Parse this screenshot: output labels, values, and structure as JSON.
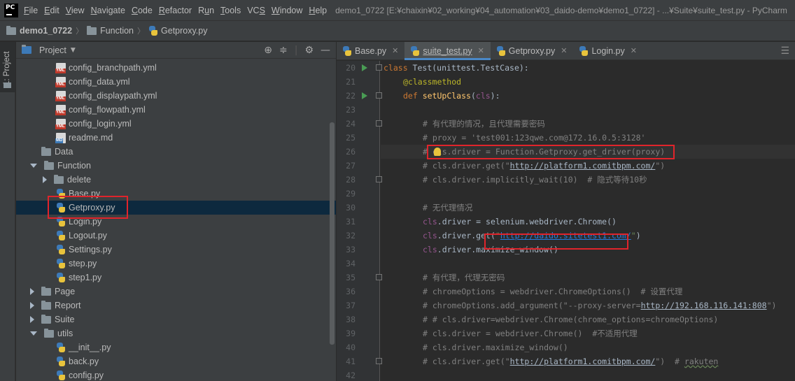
{
  "menubar": {
    "logo": "PC",
    "items": [
      {
        "pre": "",
        "ul": "F",
        "post": "ile"
      },
      {
        "pre": "",
        "ul": "E",
        "post": "dit"
      },
      {
        "pre": "",
        "ul": "V",
        "post": "iew"
      },
      {
        "pre": "",
        "ul": "N",
        "post": "avigate"
      },
      {
        "pre": "",
        "ul": "C",
        "post": "ode"
      },
      {
        "pre": "",
        "ul": "R",
        "post": "efactor"
      },
      {
        "pre": "R",
        "ul": "u",
        "post": "n"
      },
      {
        "pre": "",
        "ul": "T",
        "post": "ools"
      },
      {
        "pre": "VC",
        "ul": "S",
        "post": ""
      },
      {
        "pre": "",
        "ul": "W",
        "post": "indow"
      },
      {
        "pre": "",
        "ul": "H",
        "post": "elp"
      }
    ],
    "title": "demo1_0722 [E:¥chaixin¥02_working¥04_automation¥03_daido-demo¥demo1_0722] - ...¥Suite¥suite_test.py - PyCharm"
  },
  "breadcrumb": {
    "items": [
      "demo1_0722",
      "Function",
      "Getproxy.py"
    ]
  },
  "toolstrip": {
    "label": "1: Project"
  },
  "project_panel": {
    "title": "Project",
    "tree": [
      {
        "label": "config_branchpath.yml",
        "icon": "yml-file-icon",
        "indent": 2
      },
      {
        "label": "config_data.yml",
        "icon": "yml-file-icon",
        "indent": 2
      },
      {
        "label": "config_displaypath.yml",
        "icon": "yml-file-icon",
        "indent": 2
      },
      {
        "label": "config_flowpath.yml",
        "icon": "yml-file-icon",
        "indent": 2
      },
      {
        "label": "config_login.yml",
        "icon": "yml-file-icon",
        "indent": 2
      },
      {
        "label": "readme.md",
        "icon": "md-file-icon",
        "indent": 2
      },
      {
        "label": "Data",
        "icon": "folder-icon",
        "indent": 1,
        "arrow": "none"
      },
      {
        "label": "Function",
        "icon": "folder-icon",
        "indent": 1,
        "arrow": "down"
      },
      {
        "label": "delete",
        "icon": "folder-icon",
        "indent": 2,
        "arrow": "right"
      },
      {
        "label": "Base.py",
        "icon": "python-file-icon",
        "indent": 2
      },
      {
        "label": "Getproxy.py",
        "icon": "python-file-icon",
        "indent": 2,
        "selected": true
      },
      {
        "label": "Login.py",
        "icon": "python-file-icon",
        "indent": 2
      },
      {
        "label": "Logout.py",
        "icon": "python-file-icon",
        "indent": 2
      },
      {
        "label": "Settings.py",
        "icon": "python-file-icon",
        "indent": 2
      },
      {
        "label": "step.py",
        "icon": "python-file-icon",
        "indent": 2
      },
      {
        "label": "step1.py",
        "icon": "python-file-icon",
        "indent": 2
      },
      {
        "label": "Page",
        "icon": "folder-icon",
        "indent": 1,
        "arrow": "right"
      },
      {
        "label": "Report",
        "icon": "folder-icon",
        "indent": 1,
        "arrow": "right"
      },
      {
        "label": "Suite",
        "icon": "folder-icon",
        "indent": 1,
        "arrow": "right"
      },
      {
        "label": "utils",
        "icon": "folder-icon",
        "indent": 1,
        "arrow": "down"
      },
      {
        "label": "__init__.py",
        "icon": "python-file-icon",
        "indent": 2
      },
      {
        "label": "back.py",
        "icon": "python-file-icon",
        "indent": 2
      },
      {
        "label": "config.py",
        "icon": "python-file-icon",
        "indent": 2
      }
    ]
  },
  "editor": {
    "tabs": [
      {
        "label": "Base.py",
        "active": false
      },
      {
        "label": "suite_test.py",
        "active": true
      },
      {
        "label": "Getproxy.py",
        "active": false
      },
      {
        "label": "Login.py",
        "active": false
      }
    ],
    "lines": [
      {
        "n": "20"
      },
      {
        "n": "21"
      },
      {
        "n": "22"
      },
      {
        "n": "23"
      },
      {
        "n": "24"
      },
      {
        "n": "25"
      },
      {
        "n": "26"
      },
      {
        "n": "27"
      },
      {
        "n": "28"
      },
      {
        "n": "29"
      },
      {
        "n": "30"
      },
      {
        "n": "31"
      },
      {
        "n": "32"
      },
      {
        "n": "33"
      },
      {
        "n": "34"
      },
      {
        "n": "35"
      },
      {
        "n": "36"
      },
      {
        "n": "37"
      },
      {
        "n": "38"
      },
      {
        "n": "39"
      },
      {
        "n": "40"
      },
      {
        "n": "41"
      },
      {
        "n": "42"
      }
    ],
    "code": {
      "l20_kw": "class ",
      "l20_name": "Test(unittest.TestCase):",
      "l21": "@classmethod",
      "l22_kw": "def ",
      "l22_fn": "setUpClass",
      "l22_p1": "(",
      "l22_self": "cls",
      "l22_p2": "):",
      "l24": "# 有代理的情况，且代理需要密码",
      "l25": "# proxy = 'test001:123qwe.com@172.16.0.5:3128'",
      "l26": "# cls.driver = Function.Getproxy.get_driver(proxy)",
      "l27_pre": "# cls.driver.get(\"",
      "l27_link": "http://platform1.comitbpm.com/",
      "l27_post": "\")",
      "l28": "# cls.driver.implicitly_wait(10)  # 隐式等待10秒",
      "l30": "# 无代理情况",
      "l31_self": "cls",
      "l31_rest": ".driver = selenium.webdriver.Chrome()",
      "l32_self": "cls",
      "l32_a": ".driver.get(",
      "l32_q1": "\"",
      "l32_link": "http://daido.sitetest1.com/",
      "l32_q2": "\"",
      "l32_b": ")",
      "l33_self": "cls",
      "l33_rest": ".driver.maximize_window()",
      "l35": "# 有代理，代理无密码",
      "l36": "# chromeOptions = webdriver.ChromeOptions()  # 设置代理",
      "l37_pre": "# chromeOptions.add_argument(\"--proxy-server=",
      "l37_link": "http://192.168.116.141:808",
      "l37_post": "\")",
      "l38": "# # cls.driver=webdriver.Chrome(chrome_options=chromeOptions)",
      "l39": "# cls.driver = webdriver.Chrome()  #不适用代理",
      "l40": "# cls.driver.maximize_window()",
      "l41_pre": "# cls.driver.get(\"",
      "l41_link": "http://platform1.comitbpm.com/",
      "l41_mid": "\")  # ",
      "l41_post": "rakuten"
    }
  },
  "colors": {
    "highlight_box": "#e0242b",
    "selection": "#0d293e",
    "active_tab_underline": "#4a88c7"
  }
}
